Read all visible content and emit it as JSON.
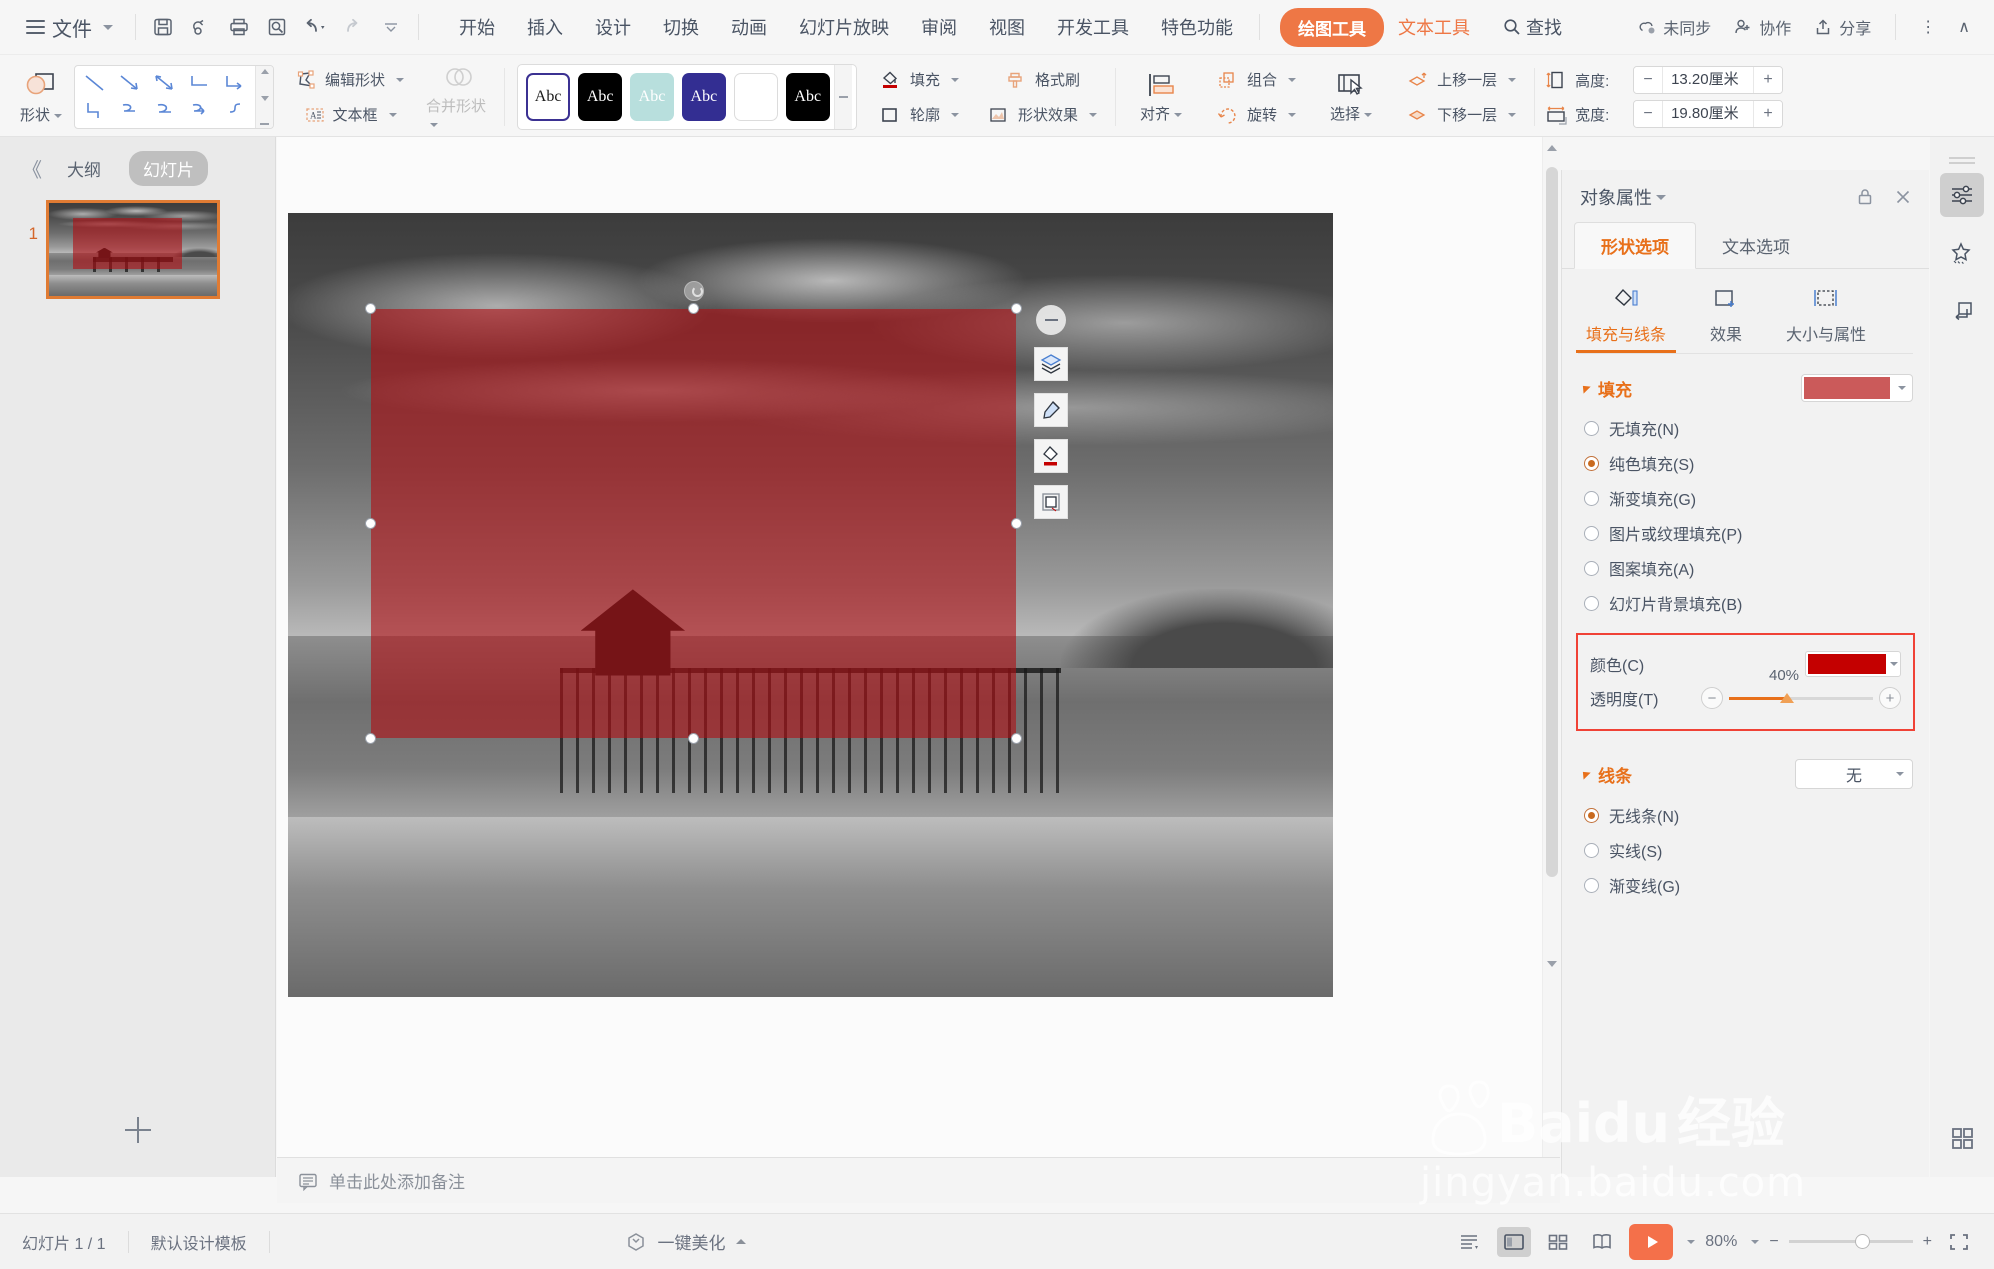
{
  "menubar": {
    "file_label": "文件",
    "quick_access": [
      {
        "name": "save-icon",
        "title": "保存"
      },
      {
        "name": "cloud-sync-icon",
        "title": "云同步"
      },
      {
        "name": "print-icon",
        "title": "打印"
      },
      {
        "name": "print-preview-icon",
        "title": "打印预览"
      },
      {
        "name": "undo-icon",
        "title": "撤销"
      },
      {
        "name": "redo-icon",
        "title": "恢复"
      },
      {
        "name": "customize-qat-icon",
        "title": "自定义快速访问工具栏"
      }
    ],
    "tabs": [
      "开始",
      "插入",
      "设计",
      "切换",
      "动画",
      "幻灯片放映",
      "审阅",
      "视图",
      "开发工具",
      "特色功能"
    ],
    "context_tab_active": "绘图工具",
    "context_tab_secondary": "文本工具",
    "find_label": "查找",
    "right_items": [
      {
        "label": "未同步",
        "icon": "cloud-unsynced-icon"
      },
      {
        "label": "协作",
        "icon": "collaborate-icon"
      },
      {
        "label": "分享",
        "icon": "share-icon"
      }
    ],
    "more_label": "⋮",
    "collapse_label": "∧"
  },
  "ribbon": {
    "shape_button": "形状",
    "edit_shape": "编辑形状",
    "text_box": "文本框",
    "merge_shapes": "合并形状",
    "fill": "填充",
    "outline": "轮廓",
    "format_painter": "格式刷",
    "shape_effects": "形状效果",
    "align": "对齐",
    "group": "组合",
    "rotate": "旋转",
    "select": "选择",
    "bring_forward": "上移一层",
    "send_backward": "下移一层",
    "height_label": "高度:",
    "height_value": "13.20厘米",
    "width_label": "宽度:",
    "width_value": "19.80厘米",
    "style_swatches": [
      {
        "name": "style-white-outline",
        "bg": "#ffffff",
        "fg": "#1a1a1a",
        "border": "#3b3192",
        "label": "Abc"
      },
      {
        "name": "style-black",
        "bg": "#000000",
        "fg": "#ffffff",
        "border": "#000000",
        "label": "Abc"
      },
      {
        "name": "style-lightteal",
        "bg": "#b8dfdd",
        "fg": "#ffffff",
        "border": "#b8dfdd",
        "label": "Abc"
      },
      {
        "name": "style-indigo",
        "bg": "#332e92",
        "fg": "#ffffff",
        "border": "#332e92",
        "label": "Abc"
      },
      {
        "name": "style-plain-white",
        "bg": "#ffffff",
        "fg": "#ffffff",
        "border": "#d8d8d8",
        "label": ""
      },
      {
        "name": "style-black-2",
        "bg": "#000000",
        "fg": "#ffffff",
        "border": "#000000",
        "label": "Abc"
      }
    ]
  },
  "left_pane": {
    "collapse_label": "《",
    "tab_outline": "大纲",
    "tab_slides": "幻灯片",
    "slide_number": "1"
  },
  "canvas": {
    "float_tools": [
      {
        "name": "layout-layers-icon",
        "title": "布局"
      },
      {
        "name": "brush-icon",
        "title": "画笔"
      },
      {
        "name": "fill-color-icon",
        "title": "填充"
      },
      {
        "name": "crop-frame-icon",
        "title": "裁剪"
      }
    ],
    "shape_fill_color": "#b00e12",
    "shape_fill_opacity": "60%"
  },
  "notes": {
    "placeholder": "单击此处添加备注"
  },
  "right_panel": {
    "title": "对象属性",
    "lock_icon": "lock-icon",
    "close_icon": "close-icon",
    "tabs": [
      {
        "label": "形状选项",
        "active": true
      },
      {
        "label": "文本选项",
        "active": false
      }
    ],
    "subtabs": [
      {
        "label": "填充与线条",
        "icon": "fill-line-icon",
        "active": true
      },
      {
        "label": "效果",
        "icon": "effects-icon",
        "active": false
      },
      {
        "label": "大小与属性",
        "icon": "size-properties-icon",
        "active": false
      }
    ],
    "fill_section": {
      "title": "填充",
      "preview_color": "#cb5a5a",
      "options": [
        {
          "label": "无填充(N)",
          "mnemonic": "N",
          "selected": false
        },
        {
          "label": "纯色填充(S)",
          "mnemonic": "S",
          "selected": true
        },
        {
          "label": "渐变填充(G)",
          "mnemonic": "G",
          "selected": false
        },
        {
          "label": "图片或纹理填充(P)",
          "mnemonic": "P",
          "selected": false
        },
        {
          "label": "图案填充(A)",
          "mnemonic": "A",
          "selected": false
        },
        {
          "label": "幻灯片背景填充(B)",
          "mnemonic": "B",
          "selected": false
        }
      ],
      "color_row_label": "颜色(C)",
      "color_value": "#c40000",
      "transparency_label": "透明度(T)",
      "transparency_value": "40%",
      "highlight_border_color": "#f04236"
    },
    "line_section": {
      "title": "线条",
      "dropdown_value": "无",
      "options": [
        {
          "label": "无线条(N)",
          "selected": true
        },
        {
          "label": "实线(S)",
          "selected": false
        },
        {
          "label": "渐变线(G)",
          "selected": false
        }
      ]
    }
  },
  "rail": {
    "buttons": [
      {
        "name": "object-properties-icon",
        "active": true
      },
      {
        "name": "magic-star-icon",
        "active": false
      },
      {
        "name": "duplicate-slide-icon",
        "active": false
      }
    ],
    "bottom_button": {
      "name": "grid-apps-icon"
    }
  },
  "statusbar": {
    "slide_count": "幻灯片 1 / 1",
    "template": "默认设计模板",
    "beautify": "一键美化",
    "view_buttons": [
      {
        "name": "reading-layout-icon",
        "active": false
      },
      {
        "name": "normal-view-icon",
        "active": true
      },
      {
        "name": "slide-sorter-icon",
        "active": false
      },
      {
        "name": "reading-view-icon",
        "active": false
      }
    ],
    "play_icon": "wps-play-icon",
    "zoom_label": "80%",
    "zoom_out": "−",
    "zoom_in": "+",
    "fullscreen_icon": "fullscreen-icon"
  },
  "watermark": {
    "brand": "Bai du 经验",
    "url": "jingyan.baidu.com"
  }
}
